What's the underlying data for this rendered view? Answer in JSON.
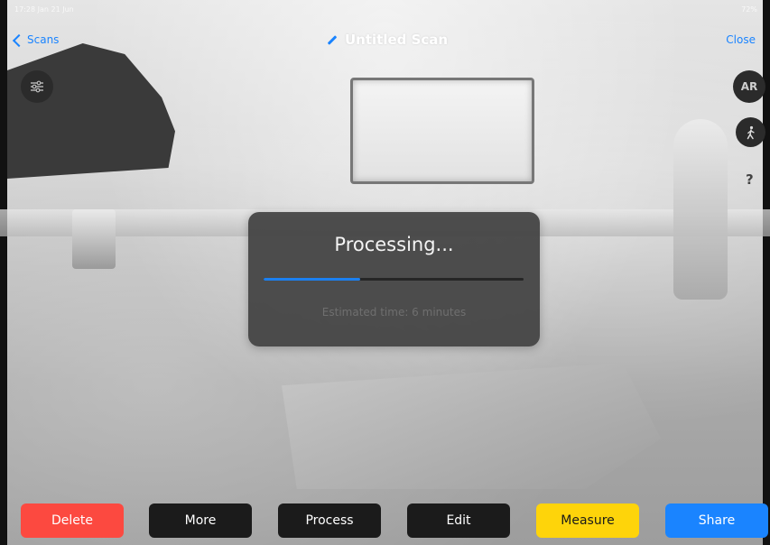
{
  "status_bar": {
    "time": "17:28",
    "date": "Jan 21 Jun",
    "right": "72%"
  },
  "nav": {
    "back_label": "Scans",
    "title": "Untitled Scan",
    "close_label": "Close"
  },
  "side_controls": {
    "ar_label": "AR",
    "help_glyph": "?"
  },
  "dialog": {
    "title": "Processing...",
    "subtitle": "Estimated time: 6 minutes",
    "progress_fraction": 0.37
  },
  "toolbar": {
    "buttons": [
      {
        "label": "Delete",
        "bg": "#fc4940",
        "fg": "#ffffff"
      },
      {
        "label": "More",
        "bg": "#1b1b1b",
        "fg": "#ffffff"
      },
      {
        "label": "Process",
        "bg": "#1b1b1b",
        "fg": "#ffffff"
      },
      {
        "label": "Edit",
        "bg": "#1b1b1b",
        "fg": "#ffffff"
      },
      {
        "label": "Measure",
        "bg": "#fed40a",
        "fg": "#1a1a1a"
      },
      {
        "label": "Share",
        "bg": "#1a84ff",
        "fg": "#ffffff"
      }
    ]
  },
  "colors": {
    "accent": "#1a84ff",
    "progress": "#1c80ef",
    "dialog_bg": "#444444"
  },
  "icons": [
    "chevron-left-icon",
    "pencil-icon",
    "sliders-icon",
    "walking-person-icon",
    "question-icon"
  ]
}
